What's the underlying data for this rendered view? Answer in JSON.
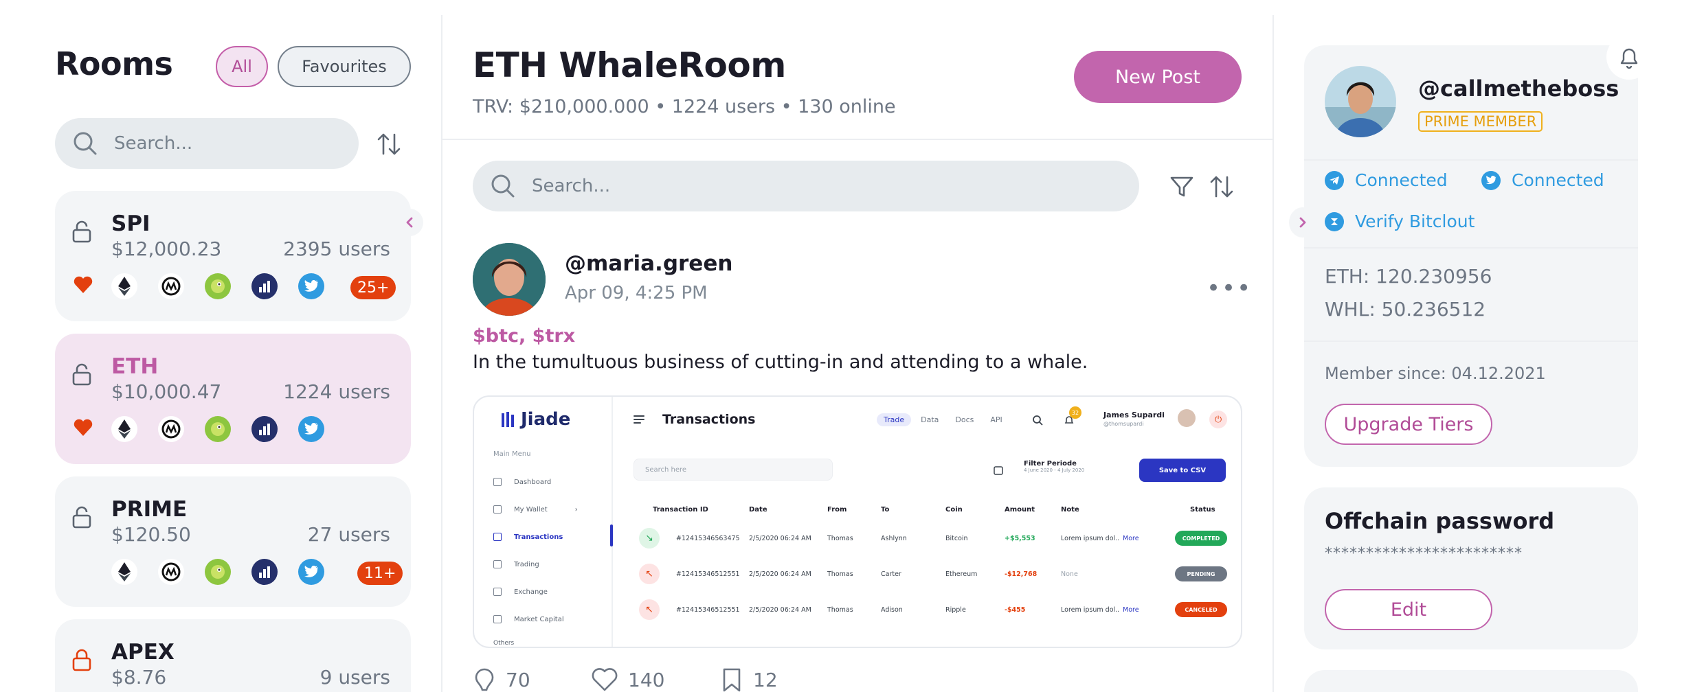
{
  "rooms": {
    "title": "Rooms",
    "filter_all": "All",
    "filter_favourites": "Favourites",
    "search_placeholder": "Search...",
    "list": [
      {
        "name": "SPI",
        "price": "$12,000.23",
        "users": "2395 users",
        "badge": "25+",
        "favourite": true,
        "active": false
      },
      {
        "name": "ETH",
        "price": "$10,000.47",
        "users": "1224 users",
        "badge": "",
        "favourite": true,
        "active": true
      },
      {
        "name": "PRIME",
        "price": "$120.50",
        "users": "27 users",
        "badge": "11+",
        "favourite": false,
        "active": false
      },
      {
        "name": "APEX",
        "price": "$8.76",
        "users": "9 users",
        "badge": "",
        "favourite": false,
        "active": false
      }
    ],
    "coin_icons": [
      "ethereum-icon",
      "coinmarketcap-icon",
      "coingecko-icon",
      "coinranking-icon",
      "twitter-icon"
    ]
  },
  "room": {
    "title": "ETH WhaleRoom",
    "subtitle": "TRV: $210,000.000 • 1224 users • 130 online",
    "new_post_label": "New Post",
    "search_placeholder": "Search..."
  },
  "post": {
    "username": "@maria.green",
    "date": "Apr 09, 4:25 PM",
    "tags": "$btc, $trx",
    "text": "In the tumultuous business of cutting-in and attending to a whale.",
    "comments": "70",
    "likes": "140",
    "saves": "12"
  },
  "embedded": {
    "logo": "Jiade",
    "menu_heading": "Main Menu",
    "nav": [
      "Dashboard",
      "My Wallet",
      "Transactions",
      "Trading",
      "Exchange",
      "Market Capital",
      "Others"
    ],
    "title": "Transactions",
    "tabs": [
      "Trade",
      "Data",
      "Docs",
      "API"
    ],
    "notif_count": "32",
    "user_name": "James Supardi",
    "user_handle": "@thomsupardi",
    "search_placeholder": "Search here",
    "filter_label": "Filter Periode",
    "filter_range": "4 June 2020 - 4 July 2020",
    "csv_label": "Save to CSV",
    "columns": [
      "Transaction ID",
      "Date",
      "From",
      "To",
      "Coin",
      "Amount",
      "Note",
      "Status"
    ],
    "rows": [
      {
        "id": "#12415346563475",
        "date": "2/5/2020 06:24 AM",
        "from": "Thomas",
        "to": "Ashlynn",
        "coin": "Bitcoin",
        "amount": "+$5,553",
        "note": "Lorem ipsum dol..",
        "more": "More",
        "status": "COMPLETED",
        "dir": "in"
      },
      {
        "id": "#12415346512551",
        "date": "2/5/2020 06:24 AM",
        "from": "Thomas",
        "to": "Carter",
        "coin": "Ethereum",
        "amount": "-$12,768",
        "note": "None",
        "more": "",
        "status": "PENDING",
        "dir": "out"
      },
      {
        "id": "#12415346512551",
        "date": "2/5/2020 06:24 AM",
        "from": "Thomas",
        "to": "Adison",
        "coin": "Ripple",
        "amount": "-$455",
        "note": "Lorem ipsum dol..",
        "more": "More",
        "status": "CANCELED",
        "dir": "out"
      }
    ]
  },
  "profile": {
    "handle": "@callmetheboss",
    "badge": "PRIME MEMBER",
    "telegram": "Connected",
    "twitter": "Connected",
    "bitclout": "Verify Bitclout",
    "eth": "ETH: 120.230956",
    "whl": "WHL: 50.236512",
    "member_since": "Member since: 04.12.2021",
    "upgrade_label": "Upgrade Tiers"
  },
  "offchain": {
    "title": "Offchain password",
    "password": "************************",
    "edit_label": "Edit"
  },
  "colors": {
    "accent": "#c265ad",
    "favourite": "#e3400e",
    "link": "#2f9be0",
    "prime": "#f0b01c"
  }
}
